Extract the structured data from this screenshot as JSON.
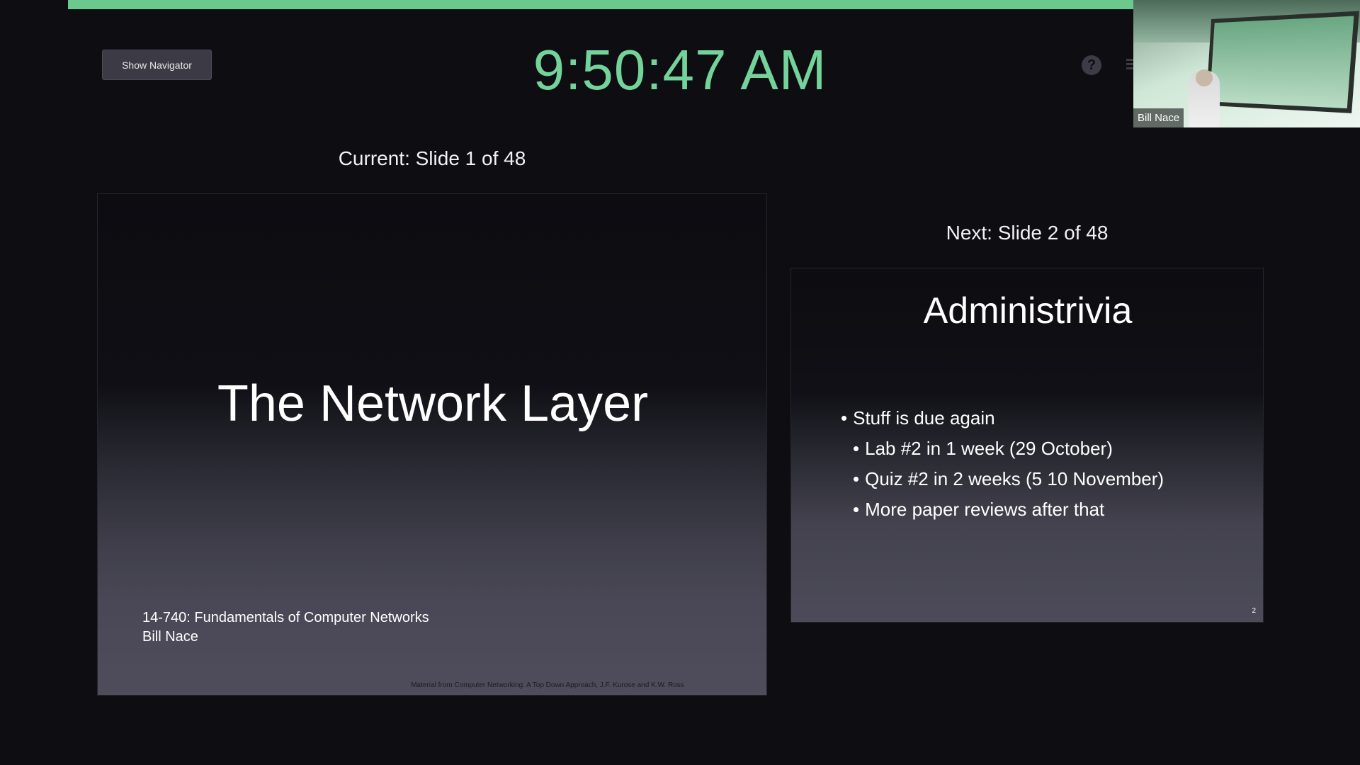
{
  "presenter": {
    "progress_fraction": 0.0208,
    "navigator_button": "Show Navigator",
    "clock": "9:50:47 AM",
    "help_icon_glyph": "?",
    "current_label": "Current: Slide 1 of 48",
    "next_label": "Next: Slide 2 of 48",
    "accent_color": "#74d39b"
  },
  "camera": {
    "name": "Bill Nace"
  },
  "current_slide": {
    "title": "The Network Layer",
    "course_line": "14-740: Fundamentals of Computer Networks",
    "author_line": "Bill Nace",
    "credit": "Material from Computer Networking: A Top Down Approach, J.F. Kurose and K.W. Ross"
  },
  "next_slide": {
    "title": "Administrivia",
    "bullets": [
      "Stuff is due again",
      "Lab #2 in 1 week (29 October)",
      "Quiz #2 in 2 weeks (5 10 November)",
      "More paper reviews after that"
    ],
    "page_number": "2"
  }
}
